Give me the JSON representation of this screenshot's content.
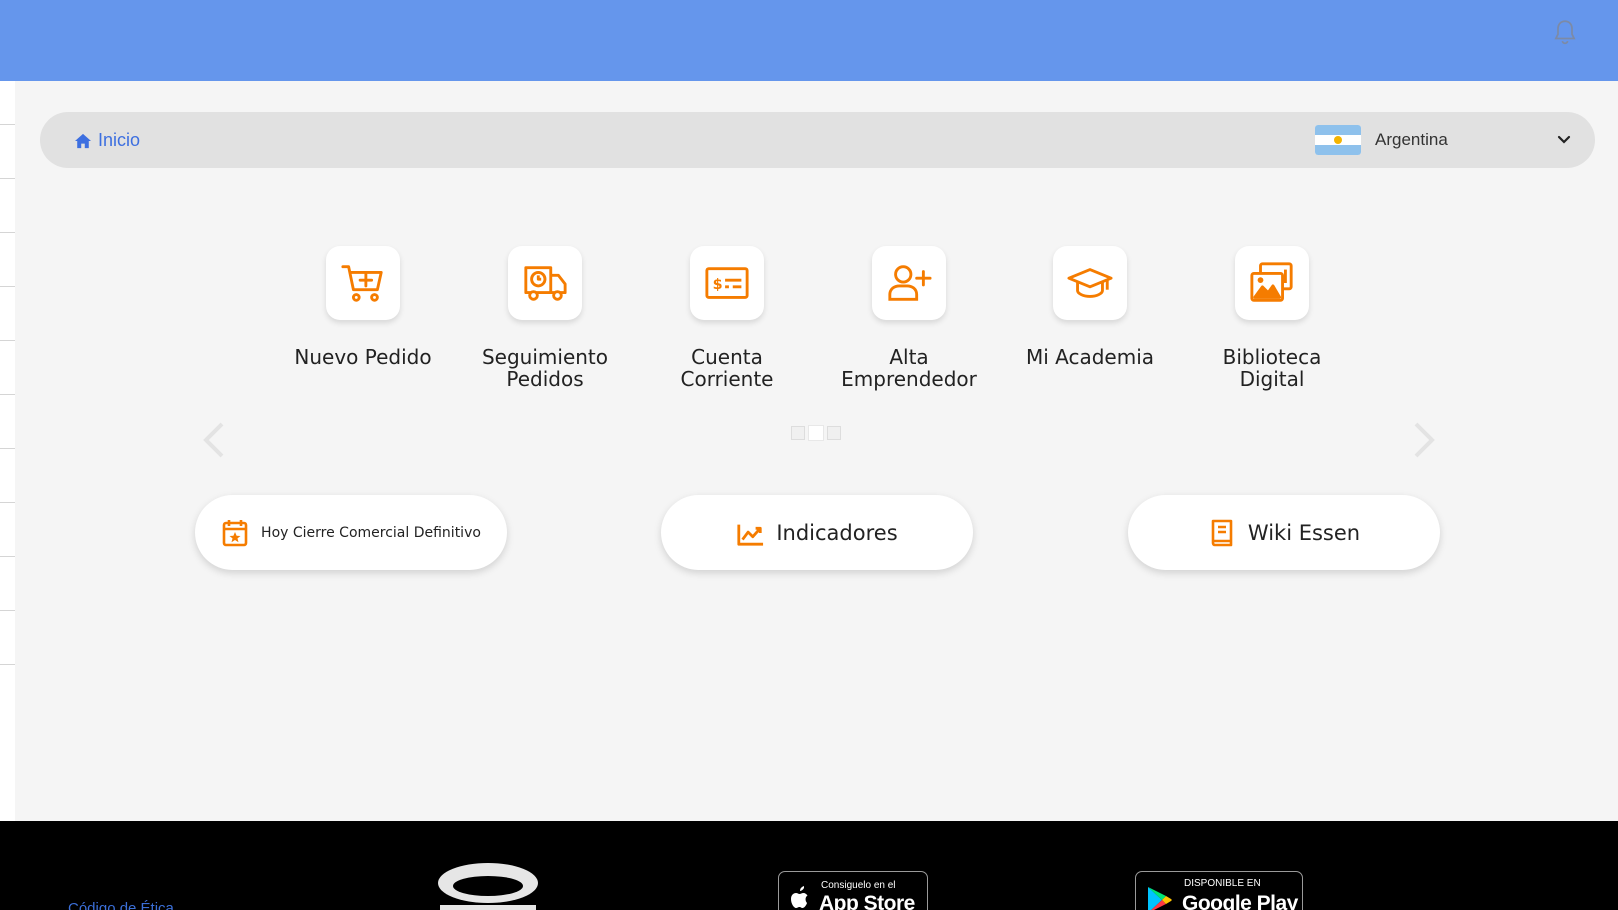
{
  "colors": {
    "header": "#6596ec",
    "accent": "#f57c00",
    "link": "#3d6fe0",
    "footer": "#000000"
  },
  "header": {
    "bell_icon": "bell-icon"
  },
  "breadcrumb": {
    "home_icon": "home-icon",
    "label": "Inicio"
  },
  "country": {
    "flag_icon": "argentina-flag-icon",
    "name": "Argentina",
    "chevron_icon": "chevron-down-icon"
  },
  "shortcuts": [
    {
      "icon": "cart-add-icon",
      "line1": "Nuevo Pedido",
      "line2": ""
    },
    {
      "icon": "delivery-truck-clock-icon",
      "line1": "Seguimiento",
      "line2": "Pedidos"
    },
    {
      "icon": "money-check-icon",
      "line1": "Cuenta",
      "line2": "Corriente"
    },
    {
      "icon": "user-plus-icon",
      "line1": "Alta",
      "line2": "Emprendedor"
    },
    {
      "icon": "graduation-cap-icon",
      "line1": "Mi Academia",
      "line2": ""
    },
    {
      "icon": "photo-gallery-icon",
      "line1": "Biblioteca",
      "line2": "Digital"
    }
  ],
  "carousel": {
    "prev_icon": "chevron-left-icon",
    "next_icon": "chevron-right-icon",
    "pages": 3,
    "active_page": 2
  },
  "actions": [
    {
      "icon": "calendar-star-icon",
      "label": "Hoy Cierre Comercial Definitivo"
    },
    {
      "icon": "chart-line-icon",
      "label": "Indicadores"
    },
    {
      "icon": "book-icon",
      "label": "Wiki Essen"
    }
  ],
  "footer": {
    "link": "Código de Ética",
    "brand_logo": "brand-logo",
    "app_store": {
      "small": "Consiguelo en el",
      "big": "App Store"
    },
    "google_play": {
      "small": "DISPONIBLE EN",
      "big": "Google Play"
    }
  }
}
